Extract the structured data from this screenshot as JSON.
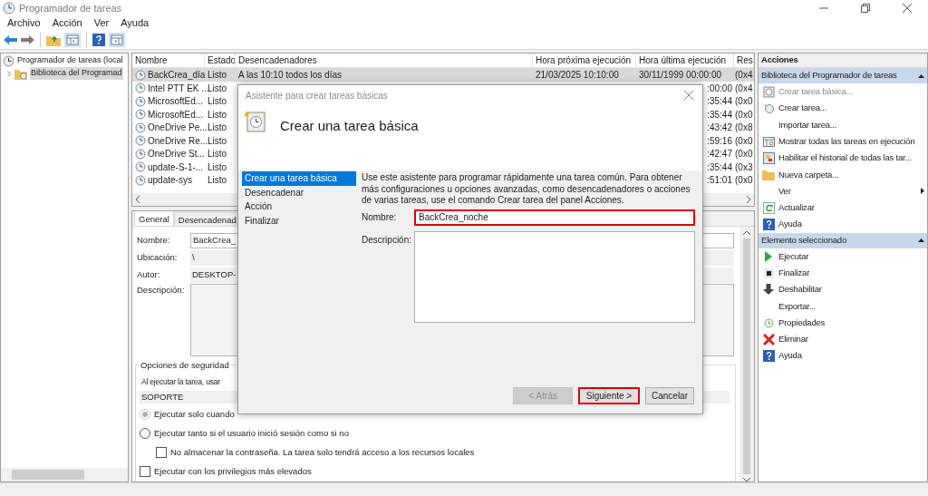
{
  "window": {
    "title": "Programador de tareas"
  },
  "menu": [
    "Archivo",
    "Acción",
    "Ver",
    "Ayuda"
  ],
  "tree": {
    "items": [
      {
        "label": "Programador de tareas (local",
        "selected": false,
        "children": [
          {
            "label": "Biblioteca del Programad",
            "selected": true,
            "expanded": false
          }
        ]
      }
    ]
  },
  "table": {
    "columns": [
      "Nombre",
      "Estado",
      "Desencadenadores",
      "Hora próxima ejecución",
      "Hora última ejecución",
      "Res"
    ],
    "rows": [
      {
        "name": "BackCrea_día",
        "status": "Listo",
        "trigger": "A las 10:10 todos los días",
        "next_run": "21/03/2025 10:10:00",
        "last_run": "30/11/1999 00:00:00",
        "result": "(0x4",
        "selected": true
      },
      {
        "name": "Intel PTT EK ...",
        "status": "Listo",
        "last_run": ":00:00",
        "result": "(0x4",
        "selected": false
      },
      {
        "name": "MicrosoftEd...",
        "status": "Listo",
        "last_run": ":35:44",
        "result": "(0x0",
        "selected": false
      },
      {
        "name": "MicrosoftEd...",
        "status": "Listo",
        "last_run": ":35:44",
        "result": "(0x0",
        "selected": false
      },
      {
        "name": "OneDrive Pe...",
        "status": "Listo",
        "last_run": ":43:42",
        "result": "(0x8",
        "selected": false
      },
      {
        "name": "OneDrive Re...",
        "status": "Listo",
        "last_run": ":59:16",
        "result": "(0x0",
        "selected": false
      },
      {
        "name": "OneDrive St...",
        "status": "Listo",
        "last_run": ":42:47",
        "result": "(0x0",
        "selected": false
      },
      {
        "name": "update-S-1-...",
        "status": "Listo",
        "last_run": ":35:44",
        "result": "(0x3",
        "selected": false
      },
      {
        "name": "update-sys",
        "status": "Listo",
        "last_run": ":51:01",
        "result": "(0x0",
        "selected": false
      }
    ]
  },
  "details": {
    "tabs": [
      {
        "label": "General",
        "selected": true
      },
      {
        "label": "Desencadenad",
        "selected": false
      }
    ],
    "fields": [
      {
        "label": "Nombre:",
        "value": "BackCrea_",
        "kind": "input"
      },
      {
        "label": "Ubicación:",
        "value": "\\",
        "kind": "text"
      },
      {
        "label": "Autor:",
        "value": "DESKTOP-",
        "kind": "text"
      },
      {
        "label": "Descripción:",
        "kind": "area"
      }
    ],
    "security": {
      "title": "Opciones de seguridad",
      "prompt": "Al ejecutar la tarea, usar",
      "account": "SOPORTE",
      "options": [
        {
          "kind": "radio",
          "label": "Ejecutar solo cuando",
          "checked": true,
          "disabled": true
        },
        {
          "kind": "radio",
          "label": "Ejecutar tanto si el usuario inició sesión como si no",
          "checked": false,
          "disabled": false,
          "children": [
            {
              "kind": "checkbox",
              "label": "No almacenar la contraseña. La tarea solo tendrá acceso a los recursos locales",
              "checked": false,
              "disabled": false
            }
          ]
        },
        {
          "kind": "checkbox",
          "label": "Ejecutar con los privilegios más elevados",
          "checked": false,
          "disabled": false
        }
      ]
    }
  },
  "actions": {
    "title": "Acciones",
    "sections": [
      {
        "title": "Biblioteca del Programador de tareas",
        "items": [
          {
            "label": "Crear tarea básica...",
            "kind": "create-basic",
            "disabled": true
          },
          {
            "label": "Crear tarea...",
            "kind": "create",
            "disabled": false
          },
          {
            "label": "Importar tarea...",
            "kind": "none",
            "disabled": false
          },
          {
            "label": "Mostrar todas las tareas en ejecución",
            "kind": "running",
            "disabled": false
          },
          {
            "label": "Habilitar el historial de todas las tar...",
            "kind": "history",
            "disabled": false
          },
          {
            "label": "Nueva carpeta...",
            "kind": "folder",
            "disabled": false
          },
          {
            "label": "Ver",
            "kind": "submenu",
            "disabled": false
          },
          {
            "label": "Actualizar",
            "kind": "refresh",
            "disabled": false
          },
          {
            "label": "Ayuda",
            "kind": "help",
            "disabled": false
          }
        ]
      },
      {
        "title": "Elemento seleccionado",
        "items": [
          {
            "label": "Ejecutar",
            "kind": "run",
            "disabled": false
          },
          {
            "label": "Finalizar",
            "kind": "stop",
            "disabled": false
          },
          {
            "label": "Deshabilitar",
            "kind": "disable",
            "disabled": false
          },
          {
            "label": "Exportar...",
            "kind": "none",
            "disabled": false
          },
          {
            "label": "Propiedades",
            "kind": "properties",
            "disabled": false
          },
          {
            "label": "Eliminar",
            "kind": "delete",
            "disabled": false
          },
          {
            "label": "Ayuda",
            "kind": "help",
            "disabled": false
          }
        ]
      }
    ]
  },
  "dialog": {
    "title": "Asistente para crear tareas básicas",
    "heading": "Crear una tarea básica",
    "steps": [
      {
        "label": "Crear una tarea básica",
        "selected": true
      },
      {
        "label": "Desencadenar",
        "selected": false
      },
      {
        "label": "Acción",
        "selected": false
      },
      {
        "label": "Finalizar",
        "selected": false
      }
    ],
    "intro": "Use este asistente para programar rápidamente una tarea común. Para obtener más configuraciones u opciones avanzadas, como desencadenadores o acciones de varias tareas, use el comando Crear tarea del panel Acciones.",
    "name_field": {
      "label": "Nombre:",
      "value": "BackCrea_noche",
      "highlighted": true
    },
    "description_field": {
      "label": "Descripción:"
    },
    "buttons": [
      {
        "label": "< Atrás",
        "disabled": true,
        "highlighted": false
      },
      {
        "label": "Siguiente >",
        "disabled": false,
        "highlighted": true
      },
      {
        "label": "Cancelar",
        "disabled": false,
        "highlighted": false
      }
    ]
  }
}
